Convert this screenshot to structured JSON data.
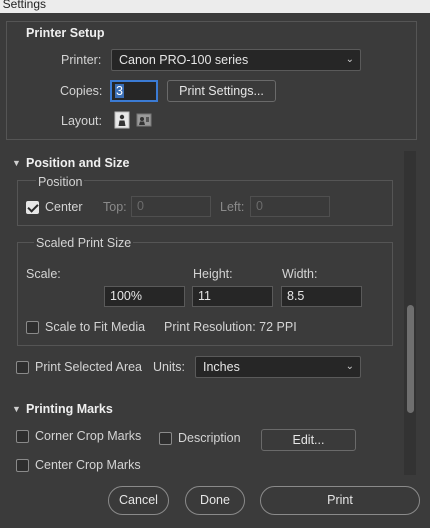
{
  "window": {
    "title": "t Settings"
  },
  "printer_setup": {
    "heading": "Printer Setup",
    "printer_label": "Printer:",
    "printer_value": "Canon PRO-100 series",
    "copies_label": "Copies:",
    "copies_value": "3",
    "print_settings_button": "Print Settings...",
    "layout_label": "Layout:",
    "layout_icons": [
      "portrait-icon",
      "landscape-icon"
    ]
  },
  "position_size": {
    "heading": "Position and Size",
    "position": {
      "heading": "Position",
      "center_label": "Center",
      "center_checked": true,
      "top_label": "Top:",
      "top_value": "0",
      "left_label": "Left:",
      "left_value": "0"
    },
    "scaled": {
      "heading": "Scaled Print Size",
      "scale_label": "Scale:",
      "scale_value": "100%",
      "height_label": "Height:",
      "height_value": "11",
      "width_label": "Width:",
      "width_value": "8.5",
      "fit_label": "Scale to Fit Media",
      "fit_checked": false,
      "resolution_text": "Print Resolution: 72 PPI"
    },
    "selected_area_label": "Print Selected Area",
    "selected_area_checked": false,
    "units_label": "Units:",
    "units_value": "Inches"
  },
  "printing_marks": {
    "heading": "Printing Marks",
    "corner_crop_label": "Corner Crop Marks",
    "description_label": "Description",
    "edit_button": "Edit...",
    "center_crop_label": "Center Crop Marks"
  },
  "footer": {
    "cancel": "Cancel",
    "done": "Done",
    "print": "Print"
  },
  "colors": {
    "background": "#3b3b3b",
    "field": "#262626",
    "focus": "#3b7bd4"
  }
}
